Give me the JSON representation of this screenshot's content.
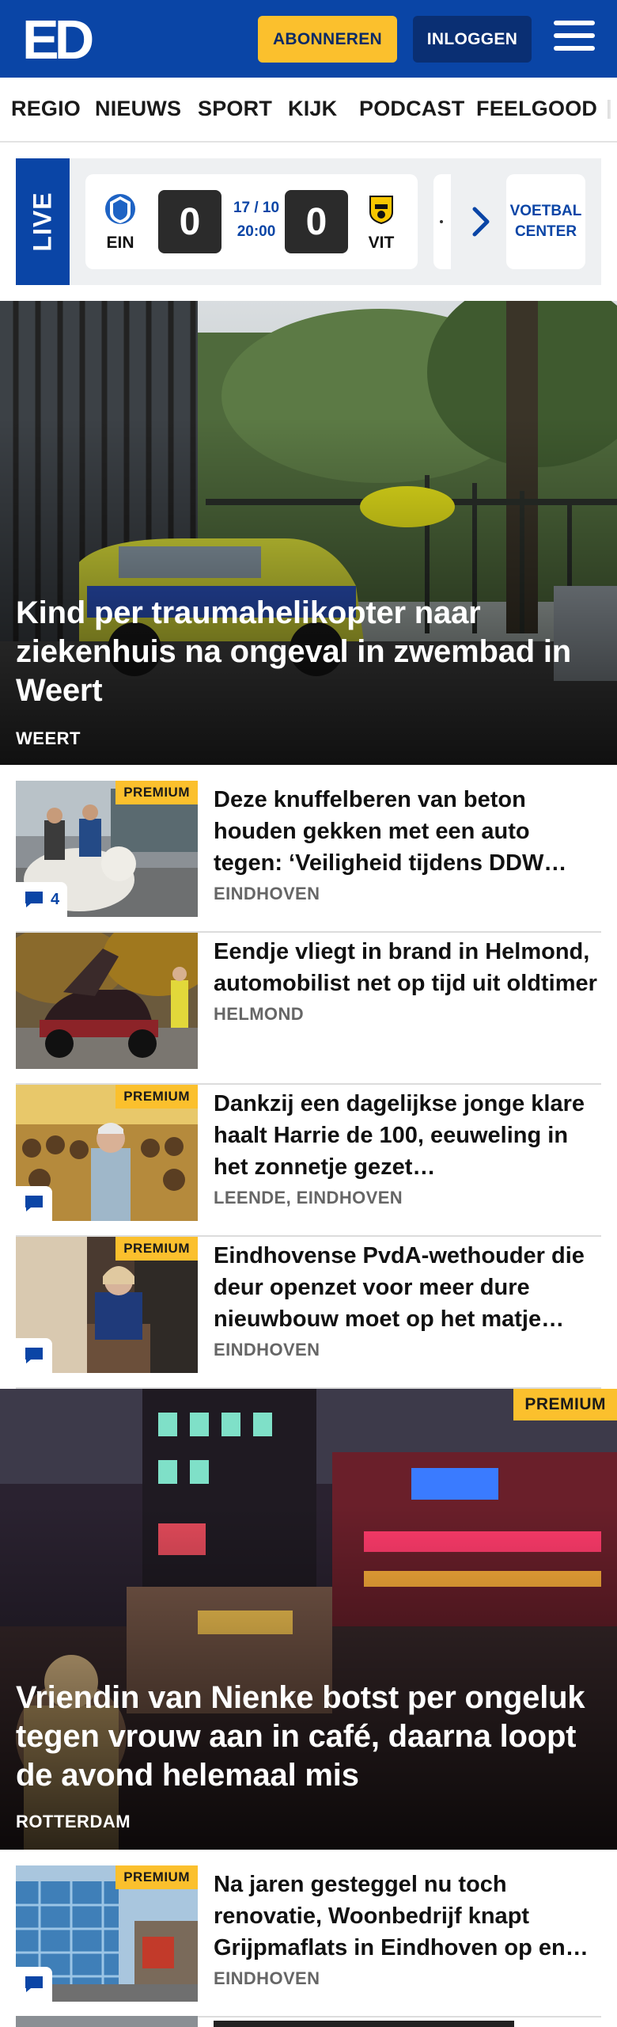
{
  "header": {
    "logo_text": "ED",
    "subscribe_label": "ABONNEREN",
    "login_label": "INLOGGEN",
    "brand_color": "#0a45a6",
    "accent_color": "#fbc02d",
    "menu_icon": "hamburger-menu-icon"
  },
  "nav": {
    "items": [
      {
        "label": "REGIO"
      },
      {
        "label": "NIEUWS"
      },
      {
        "label": "SPORT"
      },
      {
        "label": "KIJK"
      },
      {
        "label": "PODCAST"
      },
      {
        "label": "FEELGOOD"
      }
    ]
  },
  "live": {
    "label": "LIVE",
    "match": {
      "home_code": "EIN",
      "home_score": "0",
      "date": "17 / 10",
      "time": "20:00",
      "away_score": "0",
      "away_code": "VIT"
    },
    "next_icon": "chevron-right-icon",
    "center_label": "VOETBAL CENTER"
  },
  "hero1": {
    "title": "Kind per traumahelikopter naar ziekenhuis na ongeval in zwembad in Weert",
    "location": "WEERT"
  },
  "list1": [
    {
      "headline": "Deze knuffelberen van beton houden gekken met een auto tegen: ‘Veiligheid tijdens DDW…",
      "place": "EINDHOVEN",
      "premium": "PREMIUM",
      "comments": "4"
    },
    {
      "headline": "Eendje vliegt in brand in Helmond, automobilist net op tijd uit oldtimer",
      "place": "HELMOND"
    },
    {
      "headline": "Dankzij een dagelijkse jonge klare haalt Harrie de 100, eeuweling in het zonnetje gezet…",
      "place": "LEENDE, EINDHOVEN",
      "premium": "PREMIUM"
    },
    {
      "headline": "Eindhovense PvdA-wethouder die deur openzet voor meer dure nieuwbouw moet op het matje…",
      "place": "EINDHOVEN",
      "premium": "PREMIUM"
    }
  ],
  "hero2": {
    "title": "Vriendin van Nienke botst per ongeluk tegen vrouw aan in café, daarna loopt de avond helemaal mis",
    "location": "ROTTERDAM",
    "premium": "PREMIUM"
  },
  "list2": [
    {
      "headline": "Na jaren gesteggel nu toch renovatie, Woonbedrijf knapt Grijpmaflats in Eindhoven op en…",
      "place": "EINDHOVEN",
      "premium": "PREMIUM"
    }
  ]
}
